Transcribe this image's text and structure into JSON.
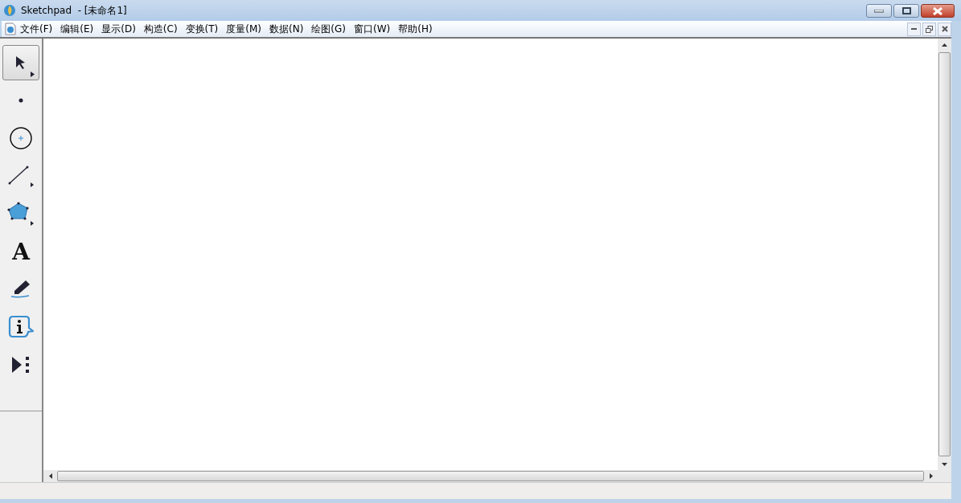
{
  "window": {
    "title": "Sketchpad  - [未命名1]"
  },
  "menu": [
    {
      "label": "文件(F)"
    },
    {
      "label": "编辑(E)"
    },
    {
      "label": "显示(D)"
    },
    {
      "label": "构造(C)"
    },
    {
      "label": "变换(T)"
    },
    {
      "label": "度量(M)"
    },
    {
      "label": "数据(N)"
    },
    {
      "label": "绘图(G)"
    },
    {
      "label": "窗口(W)"
    },
    {
      "label": "帮助(H)"
    }
  ],
  "tools": [
    {
      "kind": "arrow",
      "selected": true
    },
    {
      "kind": "point",
      "selected": false
    },
    {
      "kind": "compass",
      "selected": false
    },
    {
      "kind": "line",
      "selected": false
    },
    {
      "kind": "polygon",
      "selected": false
    },
    {
      "kind": "text",
      "selected": false,
      "glyph": "A"
    },
    {
      "kind": "marker",
      "selected": false
    },
    {
      "kind": "info",
      "selected": false
    },
    {
      "kind": "custom",
      "selected": false
    }
  ]
}
